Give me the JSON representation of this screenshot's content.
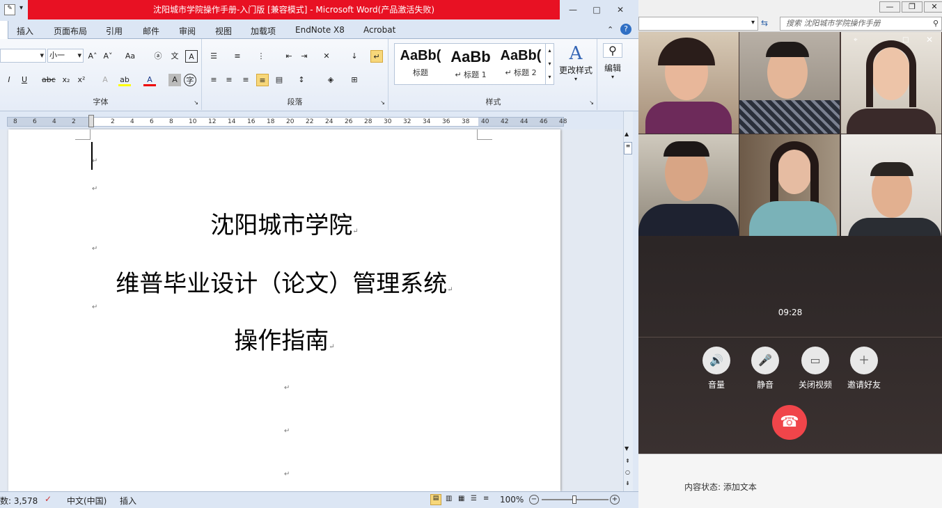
{
  "word": {
    "title": "沈阳城市学院操作手册-入门版 [兼容模式] - Microsoft Word(产品激活失败)",
    "tabs": [
      "插入",
      "页面布局",
      "引用",
      "邮件",
      "审阅",
      "视图",
      "加载项",
      "EndNote X8",
      "Acrobat"
    ],
    "font": {
      "name": "",
      "size": "小一",
      "group_label": "字体"
    },
    "paragraph_label": "段落",
    "styles": {
      "items": [
        {
          "preview": "AaBb(",
          "label": "标题"
        },
        {
          "preview": "AaBb",
          "label": "↵ 标题 1"
        },
        {
          "preview": "AaBb(",
          "label": "↵ 标题 2"
        }
      ],
      "change_label": "更改样式",
      "group_label": "样式"
    },
    "edit_label": "编辑",
    "ruler_numbers": [
      "8",
      "6",
      "4",
      "2",
      "",
      "2",
      "4",
      "6",
      "8",
      "10",
      "12",
      "14",
      "16",
      "18",
      "20",
      "22",
      "24",
      "26",
      "28",
      "30",
      "32",
      "34",
      "36",
      "38",
      "40",
      "42",
      "44",
      "46",
      "48"
    ],
    "document": {
      "line1": "沈阳城市学院",
      "line2": "维普毕业设计（论文）管理系统",
      "line3": "操作指南",
      "para_mark": "↵"
    },
    "status": {
      "words": "数: 3,578",
      "lang": "中文(中国)",
      "mode": "插入",
      "zoom": "100%"
    }
  },
  "call": {
    "search_placeholder": "搜索 沈阳城市学院操作手册",
    "timer": "09:28",
    "controls": [
      {
        "icon": "volume-icon",
        "glyph": "🔊",
        "label": "音量"
      },
      {
        "icon": "mic-icon",
        "glyph": "🎤",
        "label": "静音"
      },
      {
        "icon": "camera-icon",
        "glyph": "▭",
        "label": "关闭视频"
      },
      {
        "icon": "add-user-icon",
        "glyph": "＋",
        "label": "邀请好友"
      }
    ],
    "content_status_label": "内容状态:",
    "content_status_value": "添加文本"
  },
  "colors": {
    "hangup": "#f0454a",
    "title_bar": "#e81123"
  }
}
